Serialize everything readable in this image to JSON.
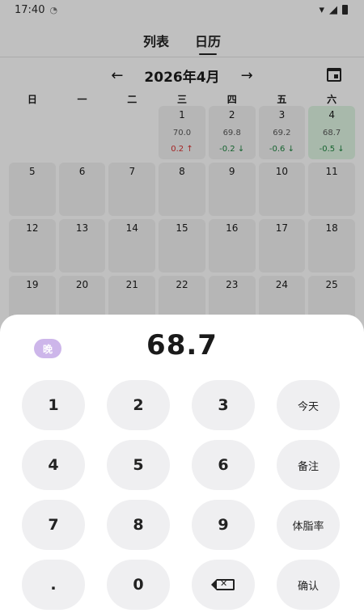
{
  "status": {
    "time": "17:40"
  },
  "tabs": [
    {
      "label": "列表"
    },
    {
      "label": "日历"
    }
  ],
  "calendar": {
    "month_title": "2026年4月",
    "weekdays": [
      "日",
      "一",
      "二",
      "三",
      "四",
      "五",
      "六"
    ],
    "cells": [
      {
        "day": "",
        "weight": "",
        "change": "",
        "dir": "",
        "empty": true
      },
      {
        "day": "",
        "weight": "",
        "change": "",
        "dir": "",
        "empty": true
      },
      {
        "day": "",
        "weight": "",
        "change": "",
        "dir": "",
        "empty": true
      },
      {
        "day": "1",
        "weight": "70.0",
        "change": "0.2 ↑",
        "dir": "up"
      },
      {
        "day": "2",
        "weight": "69.8",
        "change": "-0.2 ↓",
        "dir": "down"
      },
      {
        "day": "3",
        "weight": "69.2",
        "change": "-0.6 ↓",
        "dir": "down"
      },
      {
        "day": "4",
        "weight": "68.7",
        "change": "-0.5 ↓",
        "dir": "down",
        "selected": true
      },
      {
        "day": "5"
      },
      {
        "day": "6"
      },
      {
        "day": "7"
      },
      {
        "day": "8"
      },
      {
        "day": "9"
      },
      {
        "day": "10"
      },
      {
        "day": "11"
      },
      {
        "day": "12"
      },
      {
        "day": "13"
      },
      {
        "day": "14"
      },
      {
        "day": "15"
      },
      {
        "day": "16"
      },
      {
        "day": "17"
      },
      {
        "day": "18"
      },
      {
        "day": "19"
      },
      {
        "day": "20"
      },
      {
        "day": "21"
      },
      {
        "day": "22"
      },
      {
        "day": "23"
      },
      {
        "day": "24"
      },
      {
        "day": "25"
      }
    ]
  },
  "sheet": {
    "badge": "晚",
    "value": "68.7",
    "keys": [
      {
        "label": "1"
      },
      {
        "label": "2"
      },
      {
        "label": "3"
      },
      {
        "label": "今天",
        "fn": true
      },
      {
        "label": "4"
      },
      {
        "label": "5"
      },
      {
        "label": "6"
      },
      {
        "label": "备注",
        "fn": true
      },
      {
        "label": "7"
      },
      {
        "label": "8"
      },
      {
        "label": "9"
      },
      {
        "label": "体脂率",
        "fn": true
      },
      {
        "label": "."
      },
      {
        "label": "0"
      },
      {
        "label": "",
        "icon": "backspace-icon"
      },
      {
        "label": "确认",
        "fn": true
      }
    ]
  },
  "colors": {
    "up": "#d32f2f",
    "down": "#1b7f3c",
    "selected_bg": "#d8eedc",
    "badge_bg": "#cdb6ea"
  }
}
